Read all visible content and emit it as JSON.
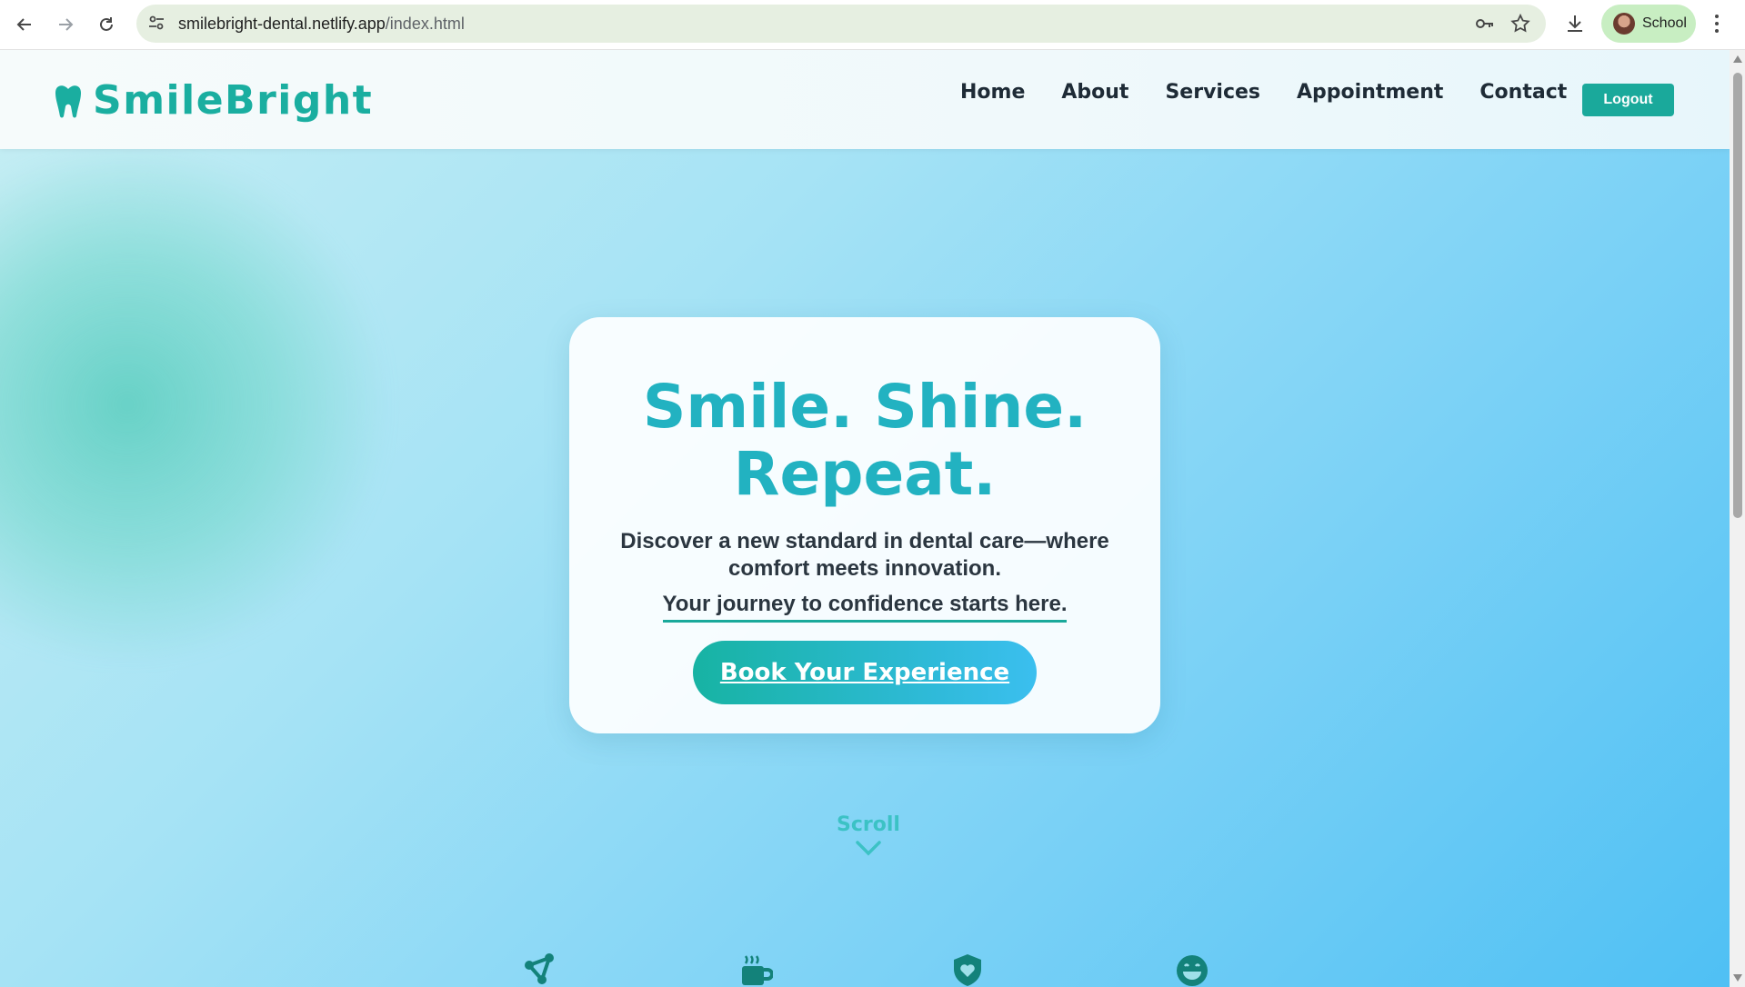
{
  "browser": {
    "url_host": "smilebright-dental.netlify.app",
    "url_path": "/index.html",
    "profile_name": "School"
  },
  "header": {
    "brand": "SmileBright",
    "nav": [
      "Home",
      "About",
      "Services",
      "Appointment",
      "Contact"
    ],
    "logout_label": "Logout"
  },
  "hero": {
    "title_line1": "Smile. Shine.",
    "title_line2": "Repeat.",
    "subtitle": "Discover a new standard in dental care—where comfort meets innovation.",
    "tagline": "Your journey to confidence starts here.",
    "cta_label": "Book Your Experience"
  },
  "scroll_hint": {
    "label": "Scroll"
  },
  "features": {
    "icons": [
      "network-icon",
      "coffee-cup-icon",
      "shield-heart-icon",
      "smile-face-icon"
    ]
  },
  "colors": {
    "brand_teal": "#1aaea0",
    "title_teal": "#22b2c1",
    "button_teal": "#1aa99b",
    "cta_gradient_end": "#3bbfef",
    "text_dark": "#2b3640"
  }
}
